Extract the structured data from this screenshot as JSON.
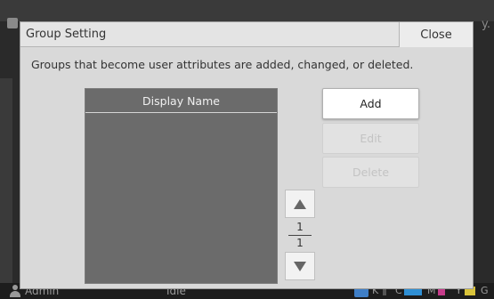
{
  "background": {
    "overflow_text": "y.",
    "status": {
      "user": "Admin",
      "state": "Idle",
      "inks": [
        {
          "label": "K",
          "color": "#2a2a2a"
        },
        {
          "label": "C",
          "color": "#2f8fd4"
        },
        {
          "label": "M",
          "color": "#c63c8b"
        },
        {
          "label": "Y",
          "color": "#d9c33a"
        },
        {
          "label": "G",
          "color": "#9a9a9a"
        }
      ]
    }
  },
  "dialog": {
    "title": "Group Setting",
    "close_label": "Close",
    "message": "Groups that become user attributes are added, changed, or deleted.",
    "list": {
      "header": "Display Name",
      "items": []
    },
    "buttons": {
      "add": "Add",
      "edit": "Edit",
      "delete": "Delete"
    },
    "pager": {
      "current": "1",
      "total": "1"
    }
  }
}
